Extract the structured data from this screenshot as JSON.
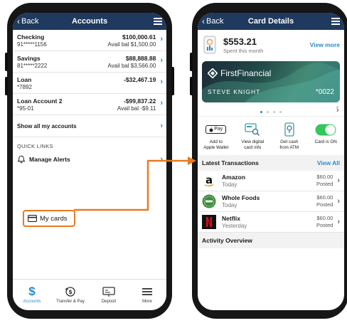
{
  "accounts_screen": {
    "back_label": "Back",
    "title": "Accounts",
    "accounts": [
      {
        "name": "Checking",
        "number": "91*****1156",
        "amount": "$100,000.61",
        "avail": "Avail bal $1,500.00"
      },
      {
        "name": "Savings",
        "number": "81*****2222",
        "amount": "$88,888.88",
        "avail": "Avail bal $3,566.00"
      },
      {
        "name": "Loan",
        "number": "*7892",
        "amount": "-$32,467.19",
        "avail": ""
      },
      {
        "name": "Loan Account 2",
        "number": "*95-01",
        "amount": "-$99,837.22",
        "avail": "Avail bal -$9.11"
      }
    ],
    "show_all_label": "Show all my accounts",
    "quick_links_header": "QUICK LINKS",
    "manage_alerts_label": "Manage Alerts",
    "my_cards_label": "My cards",
    "tabs": [
      "Accounts",
      "Transfer & Pay",
      "Deposit",
      "More"
    ]
  },
  "card_details_screen": {
    "back_label": "Back",
    "title": "Card Details",
    "spent_amount": "$553.21",
    "spent_label": "Spent this month",
    "view_more_label": "View more",
    "card": {
      "brand": "FirstFinancial",
      "holder": "STEVE KNIGHT",
      "number": "*0022"
    },
    "apple_pay_text": "Pay",
    "actions": [
      {
        "line1": "Add to",
        "line2": "Apple Wallet"
      },
      {
        "line1": "View digital",
        "line2": "card info"
      },
      {
        "line1": "Get cash",
        "line2": "from ATM"
      },
      {
        "line1": "Card is ON",
        "line2": ""
      }
    ],
    "latest_transactions_label": "Latest Transactions",
    "view_all_label": "View All",
    "transactions": [
      {
        "merchant": "Amazon",
        "date": "Today",
        "amount": "$60.00",
        "status": "Posted"
      },
      {
        "merchant": "Whole Foods",
        "date": "Today",
        "amount": "$60.00",
        "status": "Posted"
      },
      {
        "merchant": "Netflix",
        "date": "Yesterday",
        "amount": "$60.00",
        "status": "Posted"
      }
    ],
    "activity_overview_label": "Activity Overview"
  },
  "colors": {
    "header": "#1f3a5e",
    "accent": "#2a8cc8",
    "highlight": "#e97a1f",
    "toggle_on": "#34c759"
  }
}
